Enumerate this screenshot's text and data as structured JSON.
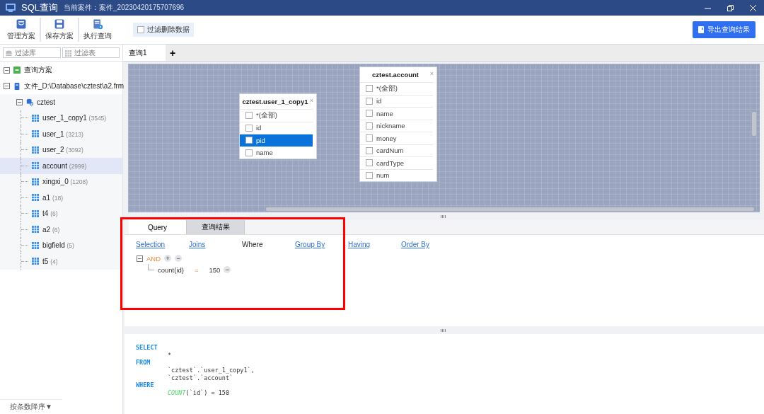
{
  "window": {
    "title": "SQL查询",
    "subtitle": "当前案件：案件_20230420175707696"
  },
  "toolbar": {
    "buttons": [
      {
        "label": "管理方案",
        "kind": "manage"
      },
      {
        "label": "保存方案",
        "kind": "save"
      },
      {
        "label": "执行查询",
        "kind": "run"
      }
    ],
    "filter_deleted": {
      "label": "过滤删除数据",
      "checked": false
    },
    "export_button": "导出查询结果"
  },
  "sidebar": {
    "filters": [
      {
        "placeholder": "过滤库",
        "kind": "db"
      },
      {
        "placeholder": "过滤表",
        "kind": "table"
      }
    ],
    "tree": [
      {
        "label": "查询方案",
        "kind": "scheme",
        "expanded": true,
        "selected": false
      },
      {
        "label": "文件_D:\\Database\\cztest\\a2.frm",
        "kind": "file",
        "expanded": true,
        "selected": false,
        "children": [
          {
            "label": "cztest",
            "kind": "database",
            "expanded": true,
            "selected": false,
            "children": [
              {
                "label": "user_1_copy1",
                "count": "(3545)",
                "kind": "table",
                "selected": false
              },
              {
                "label": "user_1",
                "count": "(3213)",
                "kind": "table",
                "selected": false
              },
              {
                "label": "user_2",
                "count": "(3092)",
                "kind": "table",
                "selected": false
              },
              {
                "label": "account",
                "count": "(2999)",
                "kind": "table",
                "selected": true
              },
              {
                "label": "xingxi_0",
                "count": "(1208)",
                "kind": "table",
                "selected": false
              },
              {
                "label": "a1",
                "count": "(18)",
                "kind": "table",
                "selected": false
              },
              {
                "label": "t4",
                "count": "(6)",
                "kind": "table",
                "selected": false
              },
              {
                "label": "a2",
                "count": "(6)",
                "kind": "table",
                "selected": false
              },
              {
                "label": "bigfield",
                "count": "(5)",
                "kind": "table",
                "selected": false
              },
              {
                "label": "t5",
                "count": "(4)",
                "kind": "table",
                "selected": false
              }
            ]
          }
        ]
      }
    ],
    "sort_label": "按条数降序▼"
  },
  "tabs": [
    {
      "label": "查询1",
      "selected": true
    }
  ],
  "add_tab": "+",
  "canvas": {
    "tables": [
      {
        "title": "cztest.user_1_copy1",
        "close": "×",
        "fields": [
          {
            "name": "*(全部)",
            "checked": false,
            "selected": false
          },
          {
            "name": "id",
            "checked": false,
            "selected": false
          },
          {
            "name": "pid",
            "checked": false,
            "selected": true
          },
          {
            "name": "name",
            "checked": false,
            "selected": false
          }
        ]
      },
      {
        "title": "cztest.account",
        "close": "×",
        "fields": [
          {
            "name": "*(全部)",
            "checked": false,
            "selected": false
          },
          {
            "name": "id",
            "checked": false,
            "selected": false
          },
          {
            "name": "name",
            "checked": false,
            "selected": false
          },
          {
            "name": "nickname",
            "checked": false,
            "selected": false
          },
          {
            "name": "money",
            "checked": false,
            "selected": false
          },
          {
            "name": "cardNum",
            "checked": false,
            "selected": false
          },
          {
            "name": "cardType",
            "checked": false,
            "selected": false
          },
          {
            "name": "num",
            "checked": false,
            "selected": false
          }
        ]
      }
    ]
  },
  "query_panel": {
    "tabs": [
      {
        "label": "Query",
        "selected": true
      },
      {
        "label": "查询结果",
        "selected": false
      }
    ],
    "sections": [
      {
        "label": "Selection",
        "selected": false
      },
      {
        "label": "Joins",
        "selected": false
      },
      {
        "label": "Where",
        "selected": true
      },
      {
        "label": "Group By",
        "selected": false
      },
      {
        "label": "Having",
        "selected": false
      },
      {
        "label": "Order By",
        "selected": false
      }
    ],
    "where": {
      "operator": "AND",
      "add": "+",
      "remove": "−",
      "conditions": [
        {
          "field": "count(id)",
          "op": "=",
          "value": "150",
          "remove": "−"
        }
      ]
    }
  },
  "sql": {
    "lines": [
      {
        "indent": false,
        "segments": [
          {
            "kind": "keyword",
            "text": "SELECT"
          }
        ]
      },
      {
        "indent": true,
        "segments": [
          {
            "kind": "plain",
            "text": "*"
          }
        ]
      },
      {
        "indent": false,
        "segments": [
          {
            "kind": "keyword",
            "text": "FROM"
          }
        ]
      },
      {
        "indent": true,
        "segments": [
          {
            "kind": "plain",
            "text": "`cztest`.`user_1_copy1`,"
          }
        ]
      },
      {
        "indent": true,
        "segments": [
          {
            "kind": "plain",
            "text": "`cztest`.`account`"
          }
        ]
      },
      {
        "indent": false,
        "segments": [
          {
            "kind": "keyword",
            "text": "WHERE"
          }
        ]
      },
      {
        "indent": true,
        "segments": [
          {
            "kind": "function",
            "text": "COUNT"
          },
          {
            "kind": "plain",
            "text": "(`id`) = 150"
          }
        ]
      }
    ]
  }
}
